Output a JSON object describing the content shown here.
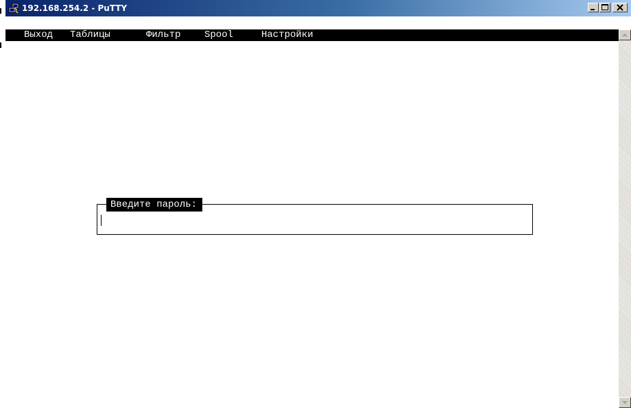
{
  "window": {
    "title": "192.168.254.2 - PuTTY",
    "icon": "putty-icon"
  },
  "title_buttons": {
    "minimize_icon": "minimize-icon",
    "maximize_icon": "maximize-icon",
    "close_icon": "close-icon"
  },
  "menu": {
    "items": [
      {
        "label": "Выход"
      },
      {
        "label": "Таблицы"
      },
      {
        "label": "Фильтр"
      },
      {
        "label": "Spool"
      },
      {
        "label": "Настройки"
      }
    ]
  },
  "password_prompt": {
    "label": "Введите пароль:",
    "value": ""
  },
  "scrollbar": {
    "up_icon": "scroll-up-arrow-icon",
    "down_icon": "scroll-down-arrow-icon"
  },
  "colors": {
    "terminal_background": "#ffffff",
    "terminal_text": "#000000",
    "titlebar_start": "#0a246a",
    "titlebar_end": "#a6caf0"
  }
}
